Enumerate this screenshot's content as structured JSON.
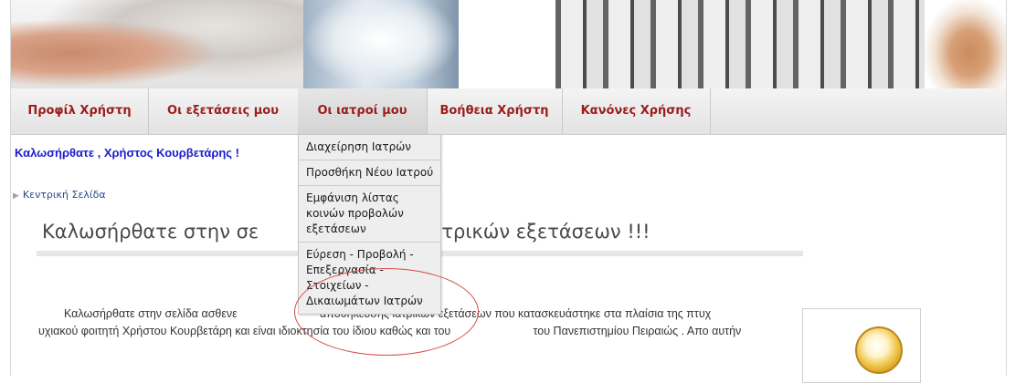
{
  "nav": {
    "items": [
      {
        "label": "Προφίλ Χρήστη"
      },
      {
        "label": "Οι εξετάσεις μου"
      },
      {
        "label": "Οι ιατροί μου"
      },
      {
        "label": "Βοήθεια Χρήστη"
      },
      {
        "label": "Κανόνες Χρήσης"
      }
    ]
  },
  "dropdown": {
    "items": [
      {
        "label": "Διαχείρηση Ιατρών"
      },
      {
        "label": "Προσθήκη Νέου Ιατρού"
      },
      {
        "label": "Εμφάνιση λίστας κοινών προβολών εξετάσεων"
      },
      {
        "label": "Εύρεση - Προβολή - Επεξεργασία - Στοιχείων - Δικαιωμάτων Ιατρών"
      }
    ]
  },
  "welcome_user": "Καλωσήρθατε , Χρήστος Κουρβετάρης !",
  "breadcrumb": "Κεντρική Σελίδα",
  "page_title": "Καλωσήρθατε στην σε                    σης ιατρικών εξετάσεων !!!",
  "body_text": "Καλωσήρθατε στην σελίδα ασθενε                          αποθήκευσης ιατρικών εξετάσεων που κατασκευάστηκε στα πλαίσια της πτυχ                          υχιακού φοιτητή Χρήστου Κουρβετάρη και είναι ιδιοκτησία του ίδιου καθώς και του                          του Πανεπιστημίου Πειραιώς . Απο αυτήν"
}
